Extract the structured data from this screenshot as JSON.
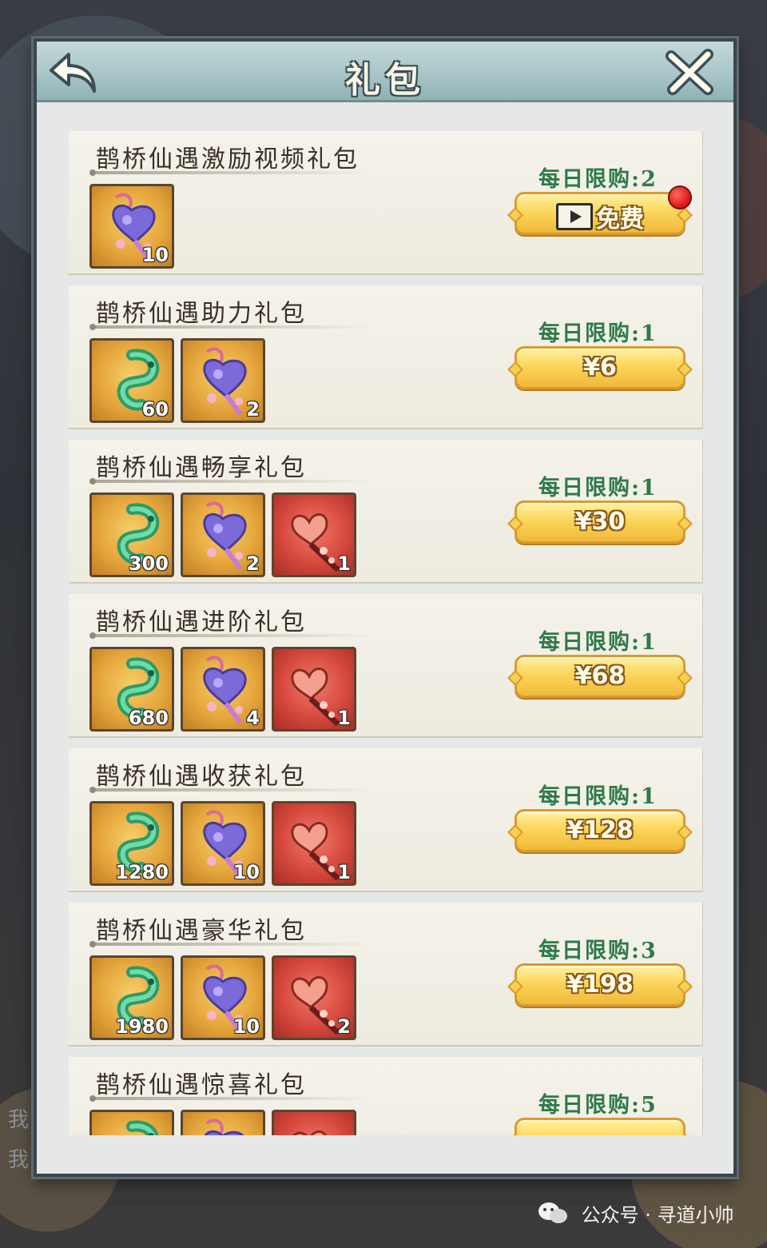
{
  "header": {
    "title": "礼包",
    "back_icon": "back-arrow-icon",
    "close_icon": "close-x-icon"
  },
  "packs": [
    {
      "name": "鹊桥仙遇激励视频礼包",
      "limit": "每日限购:2",
      "action": {
        "type": "free",
        "label": "免费",
        "icon": "video-ad-icon",
        "badge": "red-dot"
      },
      "items": [
        {
          "icon": "purple-heart-charm-icon",
          "rarity": "gold",
          "count": "10"
        }
      ]
    },
    {
      "name": "鹊桥仙遇助力礼包",
      "limit": "每日限购:1",
      "action": {
        "type": "price",
        "label": "¥6"
      },
      "items": [
        {
          "icon": "jade-dragon-icon",
          "rarity": "gold",
          "count": "60"
        },
        {
          "icon": "purple-heart-charm-icon",
          "rarity": "gold",
          "count": "2"
        }
      ]
    },
    {
      "name": "鹊桥仙遇畅享礼包",
      "limit": "每日限购:1",
      "action": {
        "type": "price",
        "label": "¥30"
      },
      "items": [
        {
          "icon": "jade-dragon-icon",
          "rarity": "gold",
          "count": "300"
        },
        {
          "icon": "purple-heart-charm-icon",
          "rarity": "gold",
          "count": "2"
        },
        {
          "icon": "heart-blossom-staff-icon",
          "rarity": "red",
          "count": "1"
        }
      ]
    },
    {
      "name": "鹊桥仙遇进阶礼包",
      "limit": "每日限购:1",
      "action": {
        "type": "price",
        "label": "¥68"
      },
      "items": [
        {
          "icon": "jade-dragon-icon",
          "rarity": "gold",
          "count": "680"
        },
        {
          "icon": "purple-heart-charm-icon",
          "rarity": "gold",
          "count": "4"
        },
        {
          "icon": "heart-blossom-staff-icon",
          "rarity": "red",
          "count": "1"
        }
      ]
    },
    {
      "name": "鹊桥仙遇收获礼包",
      "limit": "每日限购:1",
      "action": {
        "type": "price",
        "label": "¥128"
      },
      "items": [
        {
          "icon": "jade-dragon-icon",
          "rarity": "gold",
          "count": "1280"
        },
        {
          "icon": "purple-heart-charm-icon",
          "rarity": "gold",
          "count": "10"
        },
        {
          "icon": "heart-blossom-staff-icon",
          "rarity": "red",
          "count": "1"
        }
      ]
    },
    {
      "name": "鹊桥仙遇豪华礼包",
      "limit": "每日限购:3",
      "action": {
        "type": "price",
        "label": "¥198"
      },
      "items": [
        {
          "icon": "jade-dragon-icon",
          "rarity": "gold",
          "count": "1980"
        },
        {
          "icon": "purple-heart-charm-icon",
          "rarity": "gold",
          "count": "10"
        },
        {
          "icon": "heart-blossom-staff-icon",
          "rarity": "red",
          "count": "2"
        }
      ]
    },
    {
      "name": "鹊桥仙遇惊喜礼包",
      "limit": "每日限购:5",
      "action": {
        "type": "price",
        "label": ""
      },
      "items": [
        {
          "icon": "jade-dragon-icon",
          "rarity": "gold",
          "count": ""
        },
        {
          "icon": "purple-heart-charm-icon",
          "rarity": "gold",
          "count": ""
        },
        {
          "icon": "heart-blossom-staff-icon",
          "rarity": "red",
          "count": ""
        }
      ]
    }
  ],
  "background_text": [
    "我",
    "我"
  ],
  "watermark": {
    "icon": "wechat-icon",
    "text": "公众号 · 寻道小帅"
  },
  "colors": {
    "limit_text": "#2f7a4a",
    "button_gold": "#fbd65a",
    "header_teal": "#a9c6c8",
    "panel_bg": "#e6e7e7"
  }
}
